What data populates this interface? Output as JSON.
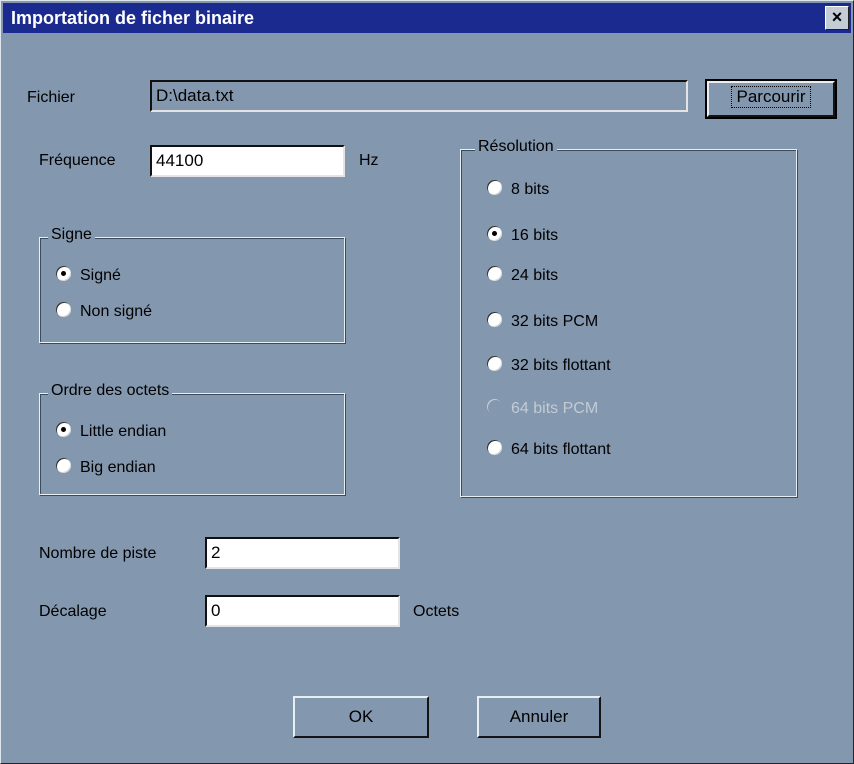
{
  "window": {
    "title": "Importation de ficher binaire",
    "close_glyph": "×"
  },
  "file": {
    "label": "Fichier",
    "value": "D:\\data.txt",
    "browse_label": "Parcourir"
  },
  "frequency": {
    "label": "Fréquence",
    "value": "44100",
    "unit": "Hz"
  },
  "sign": {
    "title": "Signe",
    "options": [
      "Signé",
      "Non signé"
    ],
    "selected": "Signé"
  },
  "byte_order": {
    "title": "Ordre des octets",
    "options": [
      "Little endian",
      "Big endian"
    ],
    "selected": "Little endian"
  },
  "resolution": {
    "title": "Résolution",
    "options": [
      "8 bits",
      "16 bits",
      "24 bits",
      "32 bits PCM",
      "32 bits flottant",
      "64 bits PCM",
      "64 bits flottant"
    ],
    "selected": "16 bits",
    "disabled": [
      "64 bits PCM"
    ]
  },
  "tracks": {
    "label": "Nombre de piste",
    "value": "2"
  },
  "offset": {
    "label": "Décalage",
    "value": "0",
    "unit": "Octets"
  },
  "buttons": {
    "ok": "OK",
    "cancel": "Annuler"
  },
  "colors": {
    "background": "#8397ae",
    "titlebar": "#1a2a8e",
    "field": "#ffffff",
    "disabled_text": "#c3cbd6"
  }
}
